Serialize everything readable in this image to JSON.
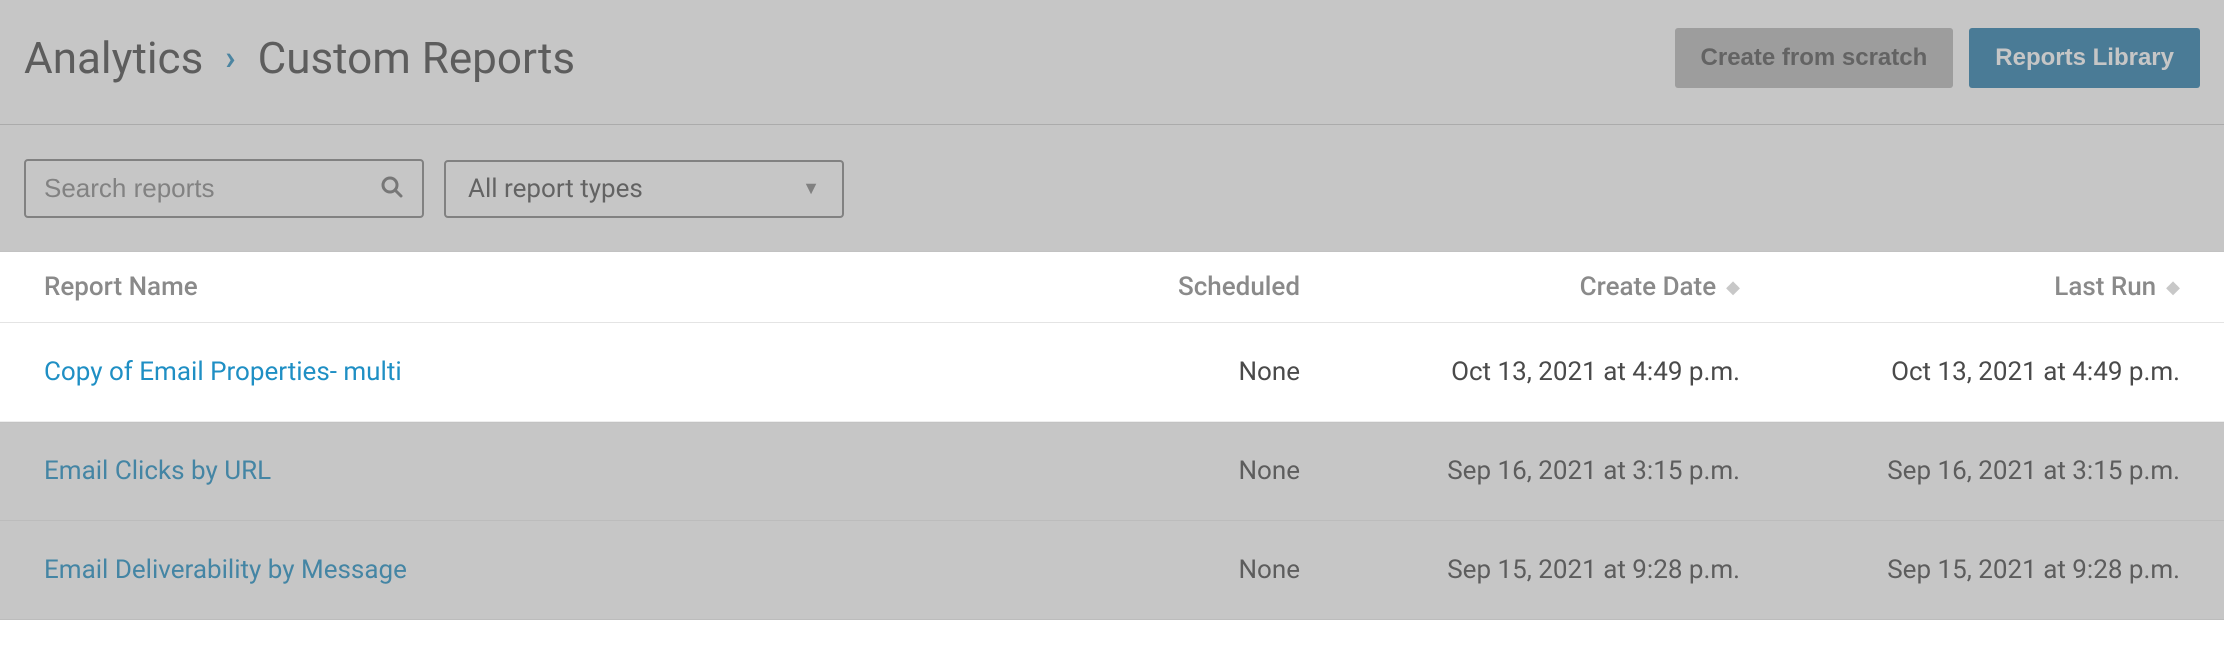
{
  "breadcrumb": {
    "root": "Analytics",
    "current": "Custom Reports"
  },
  "header_actions": {
    "create_label": "Create from scratch",
    "library_label": "Reports Library"
  },
  "toolbar": {
    "search_placeholder": "Search reports",
    "report_type_selected": "All report types"
  },
  "table": {
    "headers": {
      "name": "Report Name",
      "scheduled": "Scheduled",
      "create_date": "Create Date",
      "last_run": "Last Run"
    },
    "rows": [
      {
        "name": "Copy of Email Properties- multi",
        "scheduled": "None",
        "create_date": "Oct 13, 2021 at 4:49 p.m.",
        "last_run": "Oct 13, 2021 at 4:49 p.m.",
        "highlighted": true
      },
      {
        "name": "Email Clicks by URL",
        "scheduled": "None",
        "create_date": "Sep 16, 2021 at 3:15 p.m.",
        "last_run": "Sep 16, 2021 at 3:15 p.m.",
        "highlighted": false
      },
      {
        "name": "Email Deliverability by Message",
        "scheduled": "None",
        "create_date": "Sep 15, 2021 at 9:28 p.m.",
        "last_run": "Sep 15, 2021 at 9:28 p.m.",
        "highlighted": false
      }
    ]
  }
}
